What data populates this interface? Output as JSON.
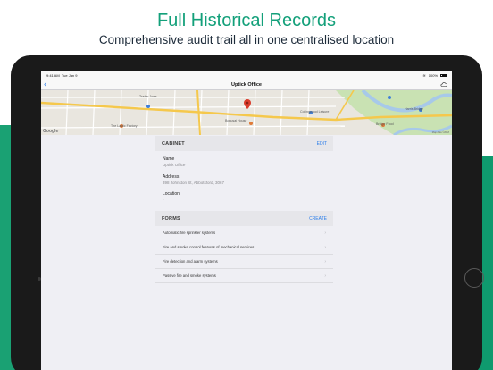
{
  "marketing": {
    "headline": "Full Historical Records",
    "subline": "Comprehensive audit trail all in one centralised location"
  },
  "status_bar": {
    "time": "9:41 AM",
    "date": "Tue Jan 9",
    "battery": "100%"
  },
  "nav": {
    "back_icon": "chevron-left-icon",
    "title": "Uptick Office",
    "cloud_icon": "cloud-icon"
  },
  "map": {
    "labels": {
      "the_lastic": "The Lastic Factory",
      "bonusai": "Bonusai House",
      "collingwood": "Collingwood Leisure",
      "harris_bridge": "Harris Bridge",
      "bridge_food": "Bridge Food",
      "trader": "Trader Joe's"
    },
    "attribution": "Google",
    "copyright": "Map data ©2018"
  },
  "cabinet": {
    "title": "CABINET",
    "edit_label": "EDIT",
    "name_label": "Name",
    "name_value": "Uptick Office",
    "address_label": "Address",
    "address_value": "398 Johnston St, Abbotsford, 3067",
    "location_label": "Location",
    "location_value": "-"
  },
  "forms": {
    "title": "FORMS",
    "create_label": "CREATE",
    "items": [
      {
        "label": "Automatic fire sprinkler systems"
      },
      {
        "label": "Fire and smoke control features of mechanical services"
      },
      {
        "label": "Fire detection and alarm systems"
      },
      {
        "label": "Passive fire and smoke systems"
      }
    ]
  },
  "colors": {
    "accent": "#2b7de9",
    "brand_teal": "#13a07a",
    "pin": "#d93b2b"
  }
}
